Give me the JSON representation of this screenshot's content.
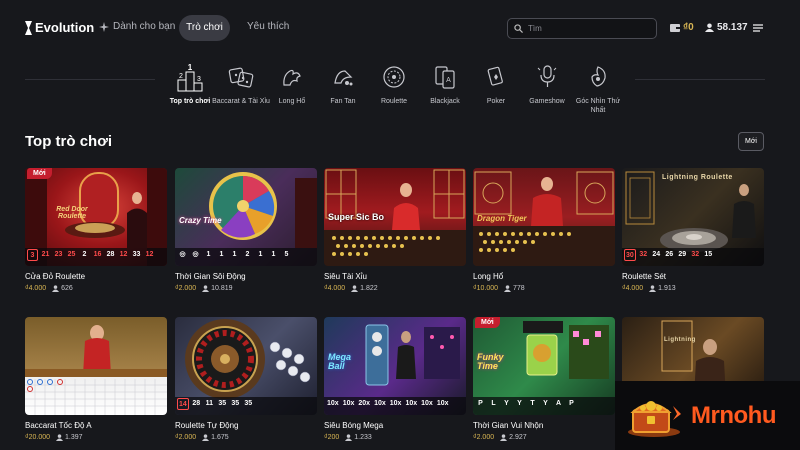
{
  "header": {
    "logo_text": "Evolution",
    "nav_for_you": "Dành cho bạn",
    "nav_games": "Trò chơi",
    "nav_favorites": "Yêu thích",
    "search_placeholder": "Tìm",
    "wallet": "₫0",
    "players": "58.137"
  },
  "categories": [
    {
      "label": "Top trò chơi",
      "icon": "top-podium-icon",
      "active": true
    },
    {
      "label": "Baccarat & Tài Xỉu",
      "icon": "dice-icon"
    },
    {
      "label": "Long Hổ",
      "icon": "dragon-tiger-icon"
    },
    {
      "label": "Fan Tan",
      "icon": "fan-tan-icon"
    },
    {
      "label": "Roulette",
      "icon": "roulette-icon"
    },
    {
      "label": "Blackjack",
      "icon": "cards-icon"
    },
    {
      "label": "Poker",
      "icon": "poker-icon"
    },
    {
      "label": "Gameshow",
      "icon": "microphone-icon"
    },
    {
      "label": "Góc Nhìn Thứ Nhất",
      "icon": "first-person-icon"
    }
  ],
  "section": {
    "title": "Top trò chơi",
    "more_label": "Mới",
    "new_badge": "Mới"
  },
  "games": [
    {
      "name": "Cửa Đỏ Roulette",
      "bet": "₫4.000",
      "players": "626",
      "new": true,
      "thumb_text": "Red Door Roulette",
      "results": [
        {
          "v": "3",
          "c": "red",
          "box": true
        },
        {
          "v": "21",
          "c": "red"
        },
        {
          "v": "23",
          "c": "red"
        },
        {
          "v": "25",
          "c": "red"
        },
        {
          "v": "2",
          "c": "white"
        },
        {
          "v": "16",
          "c": "red"
        },
        {
          "v": "28",
          "c": "white"
        },
        {
          "v": "12",
          "c": "red"
        },
        {
          "v": "33",
          "c": "white"
        },
        {
          "v": "12",
          "c": "red"
        }
      ]
    },
    {
      "name": "Thời Gian Sôi Động",
      "bet": "₫2.000",
      "players": "10.819",
      "thumb_text": "Crazy Time",
      "results": [
        {
          "v": "◎",
          "c": "white"
        },
        {
          "v": "◎",
          "c": "white"
        },
        {
          "v": "1",
          "c": "white"
        },
        {
          "v": "1",
          "c": "white"
        },
        {
          "v": "1",
          "c": "white"
        },
        {
          "v": "2",
          "c": "white"
        },
        {
          "v": "1",
          "c": "white"
        },
        {
          "v": "1",
          "c": "white"
        },
        {
          "v": "5",
          "c": "white"
        }
      ]
    },
    {
      "name": "Siêu Tài Xỉu",
      "bet": "₫4.000",
      "players": "1.822",
      "thumb_text": "Super Sic Bo",
      "results": []
    },
    {
      "name": "Long Hổ",
      "bet": "₫10.000",
      "players": "778",
      "thumb_text": "Dragon Tiger",
      "results": []
    },
    {
      "name": "Roulette Sét",
      "bet": "₫4.000",
      "players": "1.913",
      "thumb_text": "Lightning Roulette",
      "results": [
        {
          "v": "30",
          "c": "red",
          "box": true
        },
        {
          "v": "32",
          "c": "red"
        },
        {
          "v": "24",
          "c": "white"
        },
        {
          "v": "26",
          "c": "white"
        },
        {
          "v": "29",
          "c": "white"
        },
        {
          "v": "32",
          "c": "red"
        },
        {
          "v": "15",
          "c": "white"
        }
      ]
    },
    {
      "name": "Baccarat Tốc Độ A",
      "bet": "₫20.000",
      "players": "1.397",
      "thumb_text": "",
      "results": []
    },
    {
      "name": "Roulette Tự Động",
      "bet": "₫2.000",
      "players": "1.675",
      "thumb_text": "",
      "results": [
        {
          "v": "14",
          "c": "red",
          "box": true
        },
        {
          "v": "28",
          "c": "white"
        },
        {
          "v": "11",
          "c": "white"
        },
        {
          "v": "35",
          "c": "white"
        },
        {
          "v": "35",
          "c": "white"
        },
        {
          "v": "35",
          "c": "white"
        }
      ]
    },
    {
      "name": "Siêu Bóng Mega",
      "bet": "₫200",
      "players": "1.233",
      "thumb_text": "Mega Ball",
      "results": [
        {
          "v": "10x",
          "c": "white"
        },
        {
          "v": "10x",
          "c": "white"
        },
        {
          "v": "20x",
          "c": "white"
        },
        {
          "v": "10x",
          "c": "white"
        },
        {
          "v": "10x",
          "c": "white"
        },
        {
          "v": "10x",
          "c": "white"
        },
        {
          "v": "10x",
          "c": "white"
        },
        {
          "v": "10x",
          "c": "white"
        }
      ]
    },
    {
      "name": "Thời Gian Vui Nhộn",
      "bet": "₫2.000",
      "players": "2.927",
      "new": true,
      "thumb_text": "Funky Time",
      "results": [
        {
          "v": "P",
          "c": "white"
        },
        {
          "v": "L",
          "c": "white"
        },
        {
          "v": "Y",
          "c": "white"
        },
        {
          "v": "Y",
          "c": "white"
        },
        {
          "v": "T",
          "c": "white"
        },
        {
          "v": "Y",
          "c": "white"
        },
        {
          "v": "A",
          "c": "white"
        },
        {
          "v": "P",
          "c": "white"
        }
      ]
    },
    {
      "name": "",
      "bet": "",
      "players": "",
      "thumb_text": "Lightning",
      "results": []
    }
  ],
  "ad": {
    "text": "Mrnohu"
  },
  "colors": {
    "background": "#17181c",
    "accent_gold": "#d9b654",
    "new_badge": "#c51e2e",
    "result_red": "#ff4b4b"
  }
}
